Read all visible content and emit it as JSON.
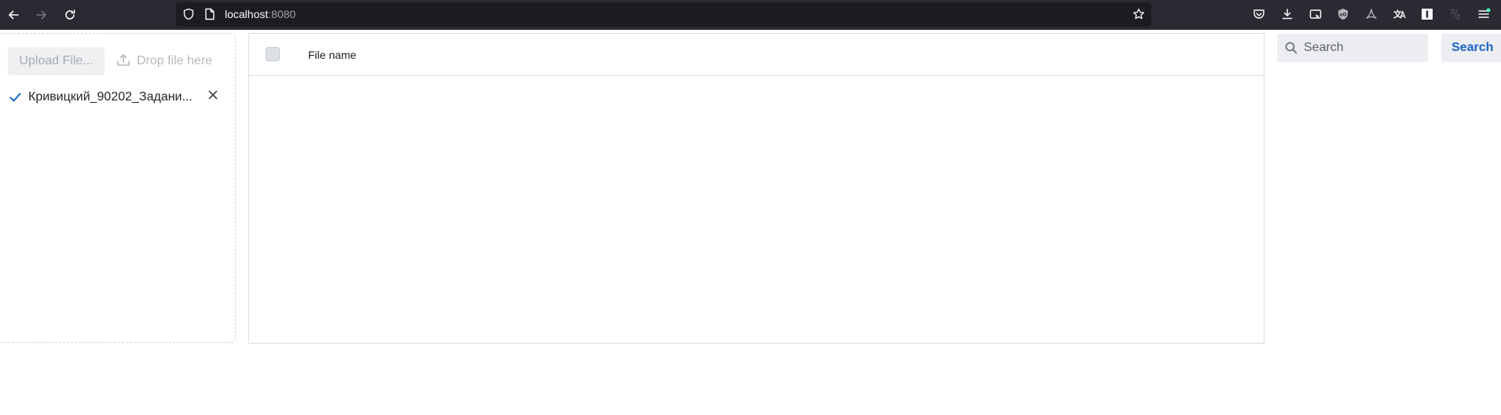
{
  "browser": {
    "url_host": "localhost",
    "url_port": ":8080"
  },
  "upload": {
    "button_label": "Upload File...",
    "drop_hint": "Drop file here",
    "files": [
      {
        "name": "Кривицкий_90202_Задани..."
      }
    ]
  },
  "table": {
    "column_filename": "File name"
  },
  "search": {
    "placeholder": "Search",
    "value": "",
    "button_label": "Search"
  },
  "colors": {
    "chrome_bg": "#2b2a33",
    "url_bg": "#1c1b22",
    "accent": "#1a64c8",
    "check": "#1a64c8"
  }
}
